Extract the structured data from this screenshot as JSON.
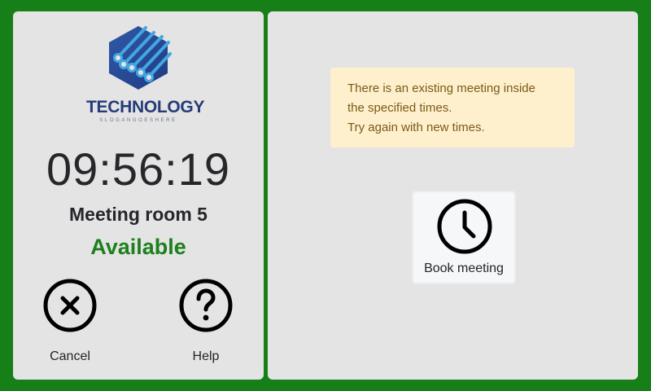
{
  "colors": {
    "background": "#177f17",
    "panel": "#e4e4e4",
    "status_available": "#1d7f1d",
    "alert_background": "#fff0cd",
    "alert_text": "#7a5a17",
    "logo_primary": "#263b78",
    "logo_accent": "#42a7e2"
  },
  "logo": {
    "icon": "circuit-hexagon-icon",
    "wordmark": "TECHNOLOGY",
    "slogan": "SLOGANGOESHERE"
  },
  "clock": {
    "time": "09:56:19"
  },
  "room": {
    "name": "Meeting room 5",
    "status": "Available"
  },
  "actions": {
    "cancel": {
      "label": "Cancel",
      "icon": "close-circle-icon"
    },
    "help": {
      "label": "Help",
      "icon": "question-circle-icon"
    }
  },
  "alert": {
    "lines": [
      "There is an existing meeting inside",
      "the specified times.",
      "Try again with new times."
    ]
  },
  "book": {
    "label": "Book meeting",
    "icon": "clock-icon"
  }
}
